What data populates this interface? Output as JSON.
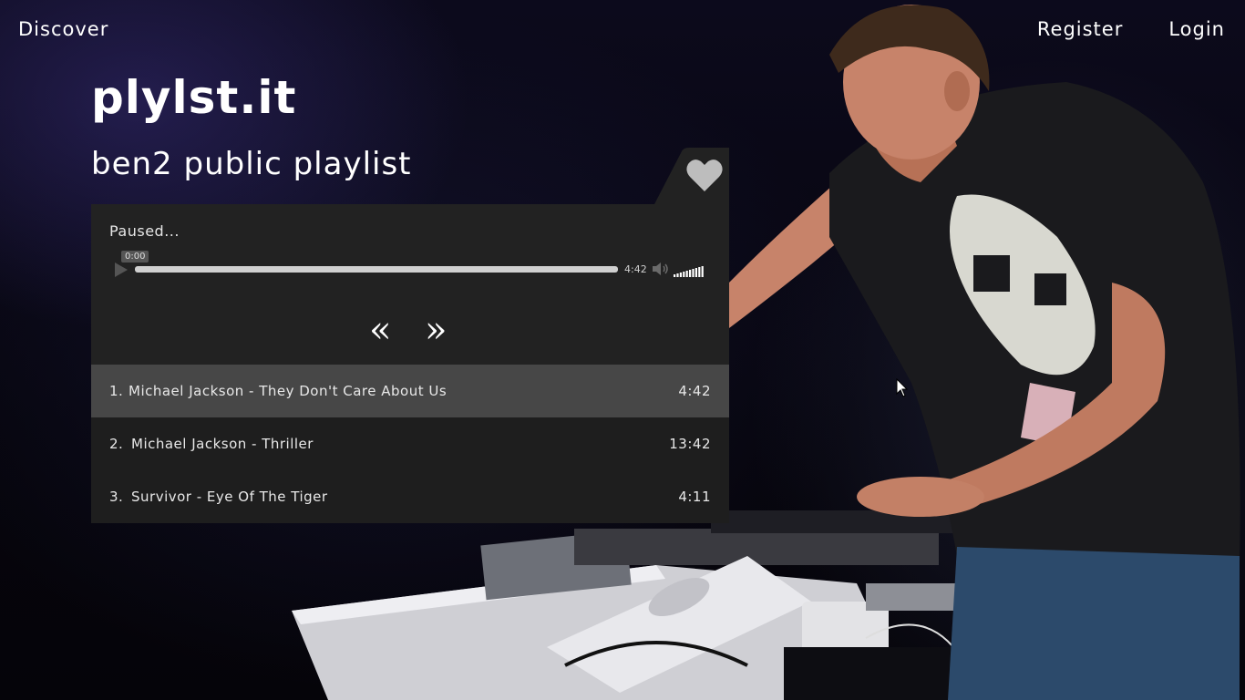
{
  "nav": {
    "discover": "Discover",
    "register": "Register",
    "login": "Login"
  },
  "site": {
    "title": "plylst.it"
  },
  "playlist": {
    "title": "ben2 public playlist"
  },
  "player": {
    "status": "Paused...",
    "current_time": "0:00",
    "duration": "4:42",
    "progress_fraction": 0.0,
    "volume_fraction": 1.0,
    "prev_symbol": "«",
    "next_symbol": "»"
  },
  "tracks": [
    {
      "num": "1.",
      "title": "Michael Jackson - They Don't Care About Us",
      "duration": "4:42",
      "active": true
    },
    {
      "num": "2.",
      "title": "Michael Jackson - Thriller",
      "duration": "13:42",
      "active": false
    },
    {
      "num": "3.",
      "title": "Survivor - Eye Of The Tiger",
      "duration": "4:11",
      "active": false
    }
  ],
  "icons": {
    "heart": "heart-icon",
    "play": "play-icon",
    "volume": "speaker-icon",
    "prev": "prev-icon",
    "next": "next-icon"
  },
  "colors": {
    "panel": "#222222",
    "active_row": "#474747",
    "row": "#1e1e1e",
    "heart": "#bdbdbd"
  }
}
